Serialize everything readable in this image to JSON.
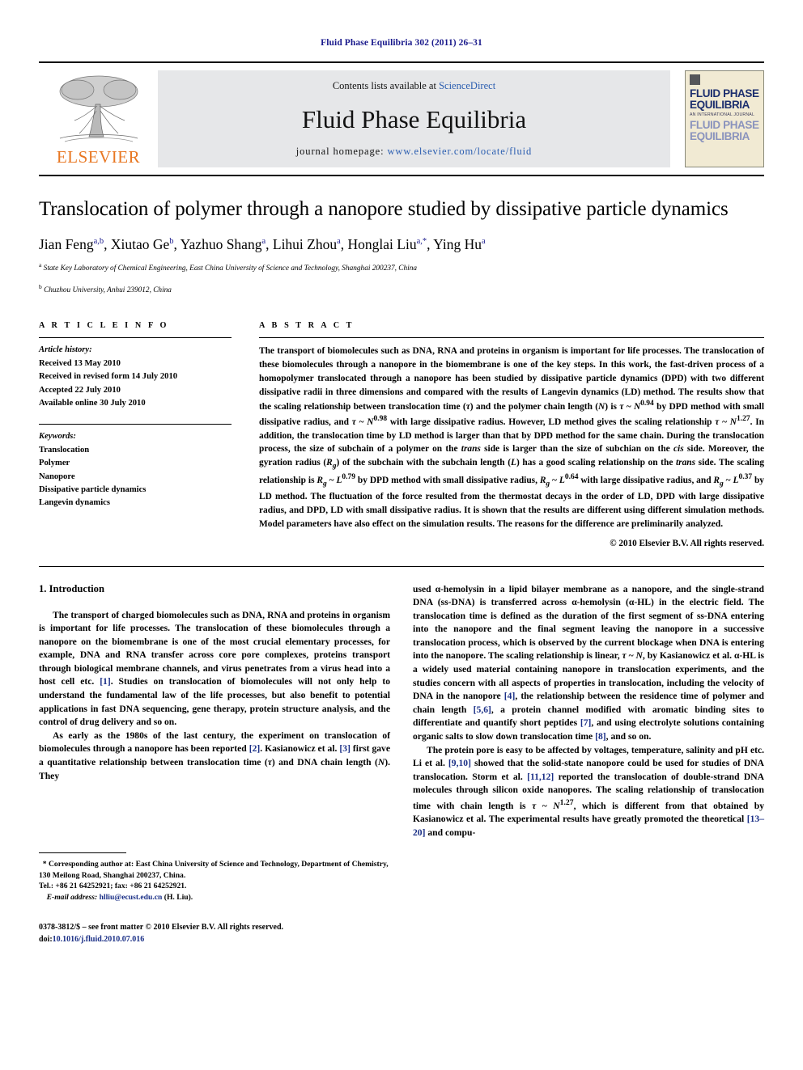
{
  "running_head": "Fluid Phase Equilibria 302 (2011) 26–31",
  "masthead": {
    "publisher": "ELSEVIER",
    "contents_prefix": "Contents lists available at ",
    "contents_link": "ScienceDirect",
    "journal_title": "Fluid Phase Equilibria",
    "homepage_prefix": "journal homepage: ",
    "homepage_url": "www.elsevier.com/locate/fluid",
    "cover": {
      "line1": "FLUID PHASE",
      "line2": "EQUILIBRIA",
      "subtitle": "AN INTERNATIONAL JOURNAL",
      "line3": "FLUID PHASE",
      "line4": "EQUILIBRIA"
    }
  },
  "article": {
    "title": "Translocation of polymer through a nanopore studied by dissipative particle dynamics",
    "authors": "Jian Feng a,b , Xiutao Ge b , Yazhuo Shang a , Lihui Zhou a , Honglai Liu a,* , Ying Hu a",
    "affiliations": [
      {
        "marker": "a",
        "text": "State Key Laboratory of Chemical Engineering, East China University of Science and Technology, Shanghai 200237, China"
      },
      {
        "marker": "b",
        "text": "Chuzhou University, Anhui 239012, China"
      }
    ]
  },
  "article_info": {
    "heading": "A R T I C L E   I N F O",
    "history_label": "Article history:",
    "history": [
      "Received 13 May 2010",
      "Received in revised form 14 July 2010",
      "Accepted 22 July 2010",
      "Available online 30 July 2010"
    ],
    "keywords_label": "Keywords:",
    "keywords": [
      "Translocation",
      "Polymer",
      "Nanopore",
      "Dissipative particle dynamics",
      "Langevin dynamics"
    ]
  },
  "abstract": {
    "heading": "A B S T R A C T",
    "text": "The transport of biomolecules such as DNA, RNA and proteins in organism is important for life processes. The translocation of these biomolecules through a nanopore in the biomembrane is one of the key steps. In this work, the fast-driven process of a homopolymer translocated through a nanopore has been studied by dissipative particle dynamics (DPD) with two different dissipative radii in three dimensions and compared with the results of Langevin dynamics (LD) method. The results show that the scaling relationship between translocation time (τ) and the polymer chain length (N) is τ ~ N0.94 by DPD method with small dissipative radius, and τ ~ N0.98 with large dissipative radius. However, LD method gives the scaling relationship τ ~ N1.27. In addition, the translocation time by LD method is larger than that by DPD method for the same chain. During the translocation process, the size of subchain of a polymer on the trans side is larger than the size of subchian on the cis side. Moreover, the gyration radius (Rg) of the subchain with the subchain length (L) has a good scaling relationship on the trans side. The scaling relationship is Rg ~ L0.79 by DPD method with small dissipative radius, Rg ~ L0.64 with large dissipative radius, and Rg ~ L0.37 by LD method. The fluctuation of the force resulted from the thermostat decays in the order of LD, DPD with large dissipative radius, and DPD, LD with small dissipative radius. It is shown that the results are different using different simulation methods. Model parameters have also effect on the simulation results. The reasons for the difference are preliminarily analyzed.",
    "copyright": "© 2010 Elsevier B.V. All rights reserved.",
    "scaling_exponents": {
      "tau_dpd_small": "0.94",
      "tau_dpd_large": "0.98",
      "tau_ld": "1.27",
      "rg_dpd_small": "0.79",
      "rg_dpd_large": "0.64",
      "rg_ld": "0.37"
    }
  },
  "body": {
    "section_number_title": "1.  Introduction",
    "left_paragraphs": [
      "The transport of charged biomolecules such as DNA, RNA and proteins in organism is important for life processes. The translocation of these biomolecules through a nanopore on the biomembrane is one of the most crucial elementary processes, for example, DNA and RNA transfer across core pore complexes, proteins transport through biological membrane channels, and virus penetrates from a virus head into a host cell etc. [1]. Studies on translocation of biomolecules will not only help to understand the fundamental law of the life processes, but also benefit to potential applications in fast DNA sequencing, gene therapy, protein structure analysis, and the control of drug delivery and so on.",
      "As early as the 1980s of the last century, the experiment on translocation of biomolecules through a nanopore has been reported [2]. Kasianowicz et al. [3] first gave a quantitative relationship between translocation time (τ) and DNA chain length (N). They"
    ],
    "right_paragraphs": [
      "used α-hemolysin in a lipid bilayer membrane as a nanopore, and the single-strand DNA (ss-DNA) is transferred across α-hemolysin (α-HL) in the electric field. The translocation time is defined as the duration of the first segment of ss-DNA entering into the nanopore and the final segment leaving the nanopore in a successive translocation process, which is observed by the current blockage when DNA is entering into the nanopore. The scaling relationship is linear, τ ~ N, by Kasianowicz et al. α-HL is a widely used material containing nanopore in translocation experiments, and the studies concern with all aspects of properties in translocation, including the velocity of DNA in the nanopore [4], the relationship between the residence time of polymer and chain length [5,6], a protein channel modified with aromatic binding sites to differentiate and quantify short peptides [7], and using electrolyte solutions containing organic salts to slow down translocation time [8], and so on.",
      "The protein pore is easy to be affected by voltages, temperature, salinity and pH etc. Li et al. [9,10] showed that the solid-state nanopore could be used for studies of DNA translocation. Storm et al. [11,12] reported the translocation of double-strand DNA molecules through silicon oxide nanopores. The scaling relationship of translocation time with chain length is τ ~ N1.27, which is different from that obtained by Kasianowicz et al. The experimental results have greatly promoted the theoretical [13–20] and compu-"
    ]
  },
  "footnote": {
    "marker": "*",
    "corresponding": "Corresponding author at: East China University of Science and Technology, Department of Chemistry, 130 Meilong Road, Shanghai 200237, China.",
    "tel": "Tel.: +86 21 64252921; fax: +86 21 64252921.",
    "email_label": "E-mail address:",
    "email": "hlliu@ecust.edu.cn",
    "email_suffix": "(H. Liu)."
  },
  "footer": {
    "issn_line": "0378-3812/$ – see front matter © 2010 Elsevier B.V. All rights reserved.",
    "doi_label": "doi:",
    "doi": "10.1016/j.fluid.2010.07.016"
  },
  "colors": {
    "link_blue": "#2a5db0",
    "ref_blue": "#1a2f86",
    "elsevier_orange": "#E87722",
    "mast_gray": "#e6e7e9"
  }
}
